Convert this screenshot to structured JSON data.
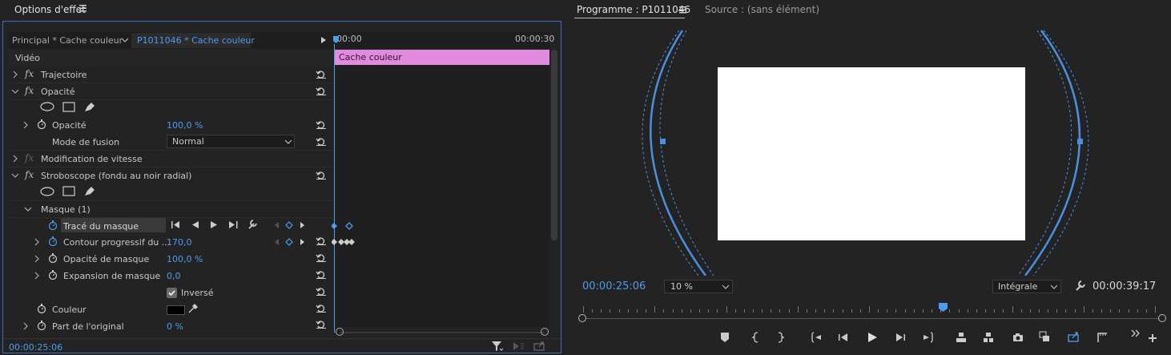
{
  "effect_controls": {
    "title": "Options d'effet",
    "source_clip": "Principal * Cache couleur",
    "target_clip": "P1011046 * Cache couleur",
    "timeline_start": "00:00",
    "timeline_end": "00:00:30",
    "clip_bar_label": "Cache couleur",
    "video_header": "Vidéo",
    "effects": {
      "trajectoire": "Trajectoire",
      "opacite": "Opacité",
      "opacite_param": "Opacité",
      "opacite_value": "100,0 %",
      "blend_label": "Mode de fusion",
      "blend_value": "Normal",
      "vitesse": "Modification de vitesse",
      "stroboscope": "Stroboscope (fondu au noir radial)",
      "masque": "Masque (1)",
      "trace": "Tracé du masque",
      "contour": "Contour progressif du ...",
      "contour_value": "170,0",
      "opacite_masque": "Opacité de masque",
      "opacite_masque_value": "100,0 %",
      "expansion": "Expansion de masque",
      "expansion_value": "0,0",
      "inverse": "Inversé",
      "couleur": "Couleur",
      "part": "Part de l'original",
      "part_value": "0 %"
    },
    "current_time": "00:00:25:06"
  },
  "program_monitor": {
    "tab_program": "Programme : P1011046",
    "tab_source": "Source : (sans élément)",
    "timecode": "00:00:25:06",
    "zoom": "10 %",
    "quality": "Intégrale",
    "duration": "00:00:39:17",
    "playhead_fraction": 0.63
  },
  "colors": {
    "accent": "#4c9cf0",
    "clip_bar": "#e28ae0",
    "panel": "#232323"
  }
}
